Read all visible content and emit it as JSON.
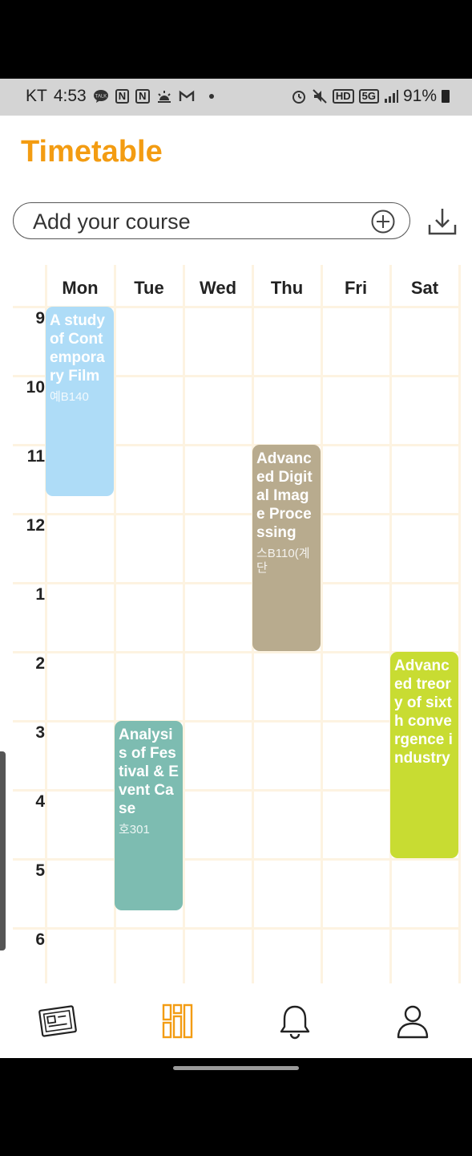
{
  "status_bar": {
    "carrier": "KT",
    "time": "4:53",
    "battery": "91%"
  },
  "header": {
    "title": "Timetable"
  },
  "search": {
    "placeholder": "Add your course"
  },
  "timetable": {
    "days": [
      "Mon",
      "Tue",
      "Wed",
      "Thu",
      "Fri",
      "Sat"
    ],
    "hours": [
      "9",
      "10",
      "11",
      "12",
      "1",
      "2",
      "3",
      "4",
      "5",
      "6"
    ],
    "courses": [
      {
        "name": "A study of Contemporary Film",
        "room": "예B140",
        "day": "Mon",
        "start": "9:00",
        "end": "11:45",
        "color": "#aedcf7"
      },
      {
        "name": "Advanced Digital Image Processing",
        "room": "스B110(계단",
        "day": "Thu",
        "start": "11:00",
        "end": "14:00",
        "color": "#b8ab8e"
      },
      {
        "name": "Advanced treory of sixth convergence industry",
        "room": "",
        "day": "Sat",
        "start": "14:00",
        "end": "17:00",
        "color": "#c8dc32"
      },
      {
        "name": "Analysis of Festival & Event Case",
        "room": "호301",
        "day": "Tue",
        "start": "15:00",
        "end": "17:45",
        "color": "#7dbcb1"
      }
    ]
  },
  "nav": {
    "items": [
      {
        "icon": "card-icon",
        "color": "#222222"
      },
      {
        "icon": "timetable-icon",
        "color": "#f39c12",
        "active": true
      },
      {
        "icon": "bell-icon",
        "color": "#222222"
      },
      {
        "icon": "profile-icon",
        "color": "#222222"
      }
    ]
  },
  "colors": {
    "accent": "#f39c12",
    "grid_line": "#fdf3e1"
  }
}
